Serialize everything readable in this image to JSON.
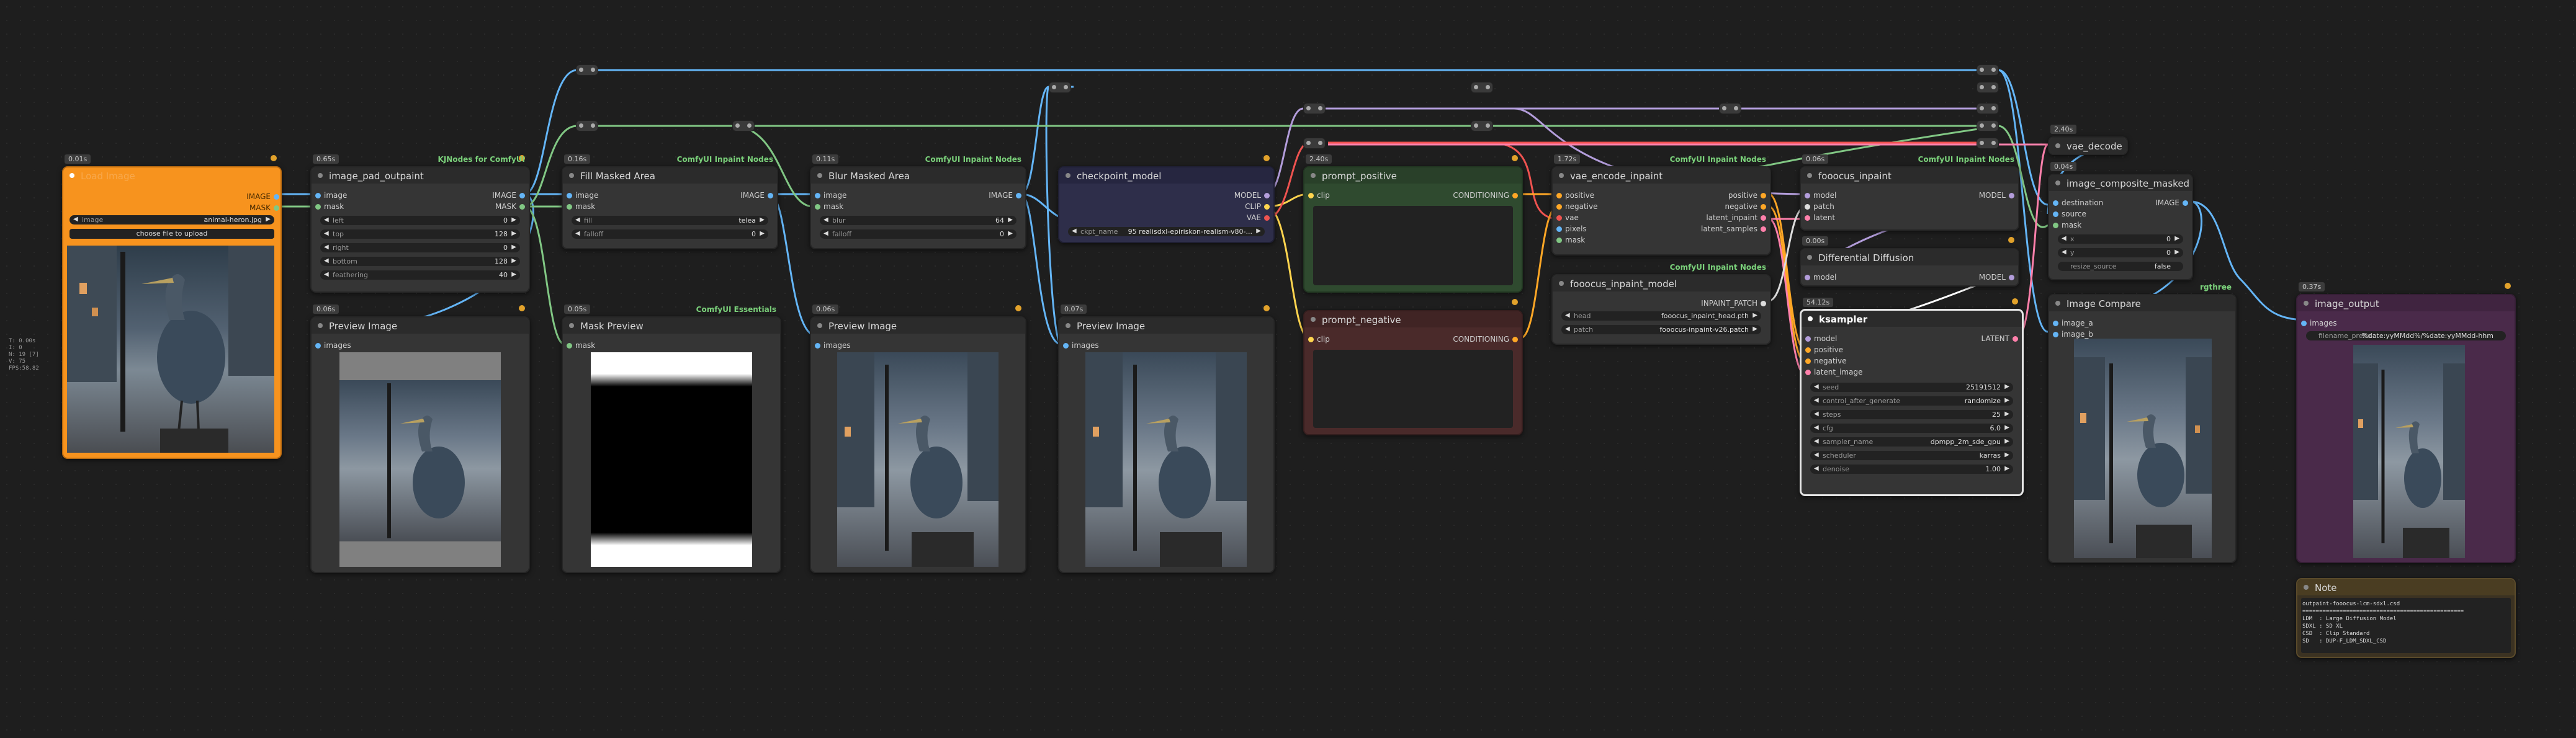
{
  "stats": [
    "T: 0.00s",
    "I: 0",
    "N: 19 [7]",
    "V: 75",
    "FPS:58.82"
  ],
  "colors": {
    "background": "#1e1e1e",
    "node_body": "#353535",
    "load_image": "#f7931e",
    "checkpoint": "#2e2e4a",
    "positive": "#2f4a2f",
    "negative": "#4a2a2a",
    "image_output": "#4a2a4a",
    "note": "#3b3222"
  },
  "nodes": {
    "load_image": {
      "title": "Load Image",
      "time": "0.01s",
      "image_label": "image",
      "image_value": "animal-heron.jpg",
      "upload_label": "choose file to upload",
      "outputs": [
        "IMAGE",
        "MASK"
      ]
    },
    "image_pad": {
      "title": "image_pad_outpaint",
      "time": "0.65s",
      "source": "KJNodes for ComfyUI",
      "inputs": [
        "image",
        "mask"
      ],
      "outputs": [
        "IMAGE",
        "MASK"
      ],
      "widgets": [
        {
          "label": "left",
          "value": "0"
        },
        {
          "label": "top",
          "value": "128"
        },
        {
          "label": "right",
          "value": "0"
        },
        {
          "label": "bottom",
          "value": "128"
        },
        {
          "label": "feathering",
          "value": "40"
        }
      ]
    },
    "fill_masked": {
      "title": "Fill Masked Area",
      "time": "0.16s",
      "source": "ComfyUI Inpaint Nodes",
      "inputs": [
        "image",
        "mask"
      ],
      "outputs": [
        "IMAGE"
      ],
      "widgets": [
        {
          "label": "fill",
          "value": "telea"
        },
        {
          "label": "falloff",
          "value": "0"
        }
      ]
    },
    "blur_masked": {
      "title": "Blur Masked Area",
      "time": "0.11s",
      "source": "ComfyUI Inpaint Nodes",
      "inputs": [
        "image",
        "mask"
      ],
      "outputs": [
        "IMAGE"
      ],
      "widgets": [
        {
          "label": "blur",
          "value": "64"
        },
        {
          "label": "falloff",
          "value": "0"
        }
      ]
    },
    "checkpoint": {
      "title": "checkpoint_model",
      "outputs": [
        "MODEL",
        "CLIP",
        "VAE"
      ],
      "ckpt_label": "ckpt_name",
      "ckpt_value": "95 realisdxl-epiriskon-realism-v80-..."
    },
    "prompt_positive": {
      "title": "prompt_positive",
      "time": "2.40s",
      "inputs": [
        "clip"
      ],
      "outputs": [
        "CONDITIONING"
      ]
    },
    "prompt_negative": {
      "title": "prompt_negative",
      "inputs": [
        "clip"
      ],
      "outputs": [
        "CONDITIONING"
      ]
    },
    "vae_encode": {
      "title": "vae_encode_inpaint",
      "time": "1.72s",
      "source": "ComfyUI Inpaint Nodes",
      "inputs": [
        "positive",
        "negative",
        "vae",
        "pixels",
        "mask"
      ],
      "outputs": [
        "positive",
        "negative",
        "latent_inpaint",
        "latent_samples"
      ]
    },
    "fooocus_model": {
      "title": "fooocus_inpaint_model",
      "source": "ComfyUI Inpaint Nodes",
      "outputs": [
        "INPAINT_PATCH"
      ],
      "widgets": [
        {
          "label": "head",
          "value": "fooocus_inpaint_head.pth"
        },
        {
          "label": "patch",
          "value": "fooocus-inpaint-v26.patch"
        }
      ]
    },
    "fooocus_inpaint": {
      "title": "fooocus_inpaint",
      "time": "0.06s",
      "source": "ComfyUI Inpaint Nodes",
      "inputs": [
        "model",
        "patch",
        "latent"
      ],
      "outputs": [
        "MODEL"
      ]
    },
    "diff_diffusion": {
      "title": "Differential Diffusion",
      "time": "0.00s",
      "inputs": [
        "model"
      ],
      "outputs": [
        "MODEL"
      ]
    },
    "ksampler": {
      "title": "ksampler",
      "time": "54.12s",
      "inputs": [
        "model",
        "positive",
        "negative",
        "latent_image"
      ],
      "outputs": [
        "LATENT"
      ],
      "widgets": [
        {
          "label": "seed",
          "value": "25191512"
        },
        {
          "label": "control_after_generate",
          "value": "randomize"
        },
        {
          "label": "steps",
          "value": "25"
        },
        {
          "label": "cfg",
          "value": "6.0"
        },
        {
          "label": "sampler_name",
          "value": "dpmpp_2m_sde_gpu"
        },
        {
          "label": "scheduler",
          "value": "karras"
        },
        {
          "label": "denoise",
          "value": "1.00"
        }
      ]
    },
    "vae_decode": {
      "title": "vae_decode",
      "time": "2.40s"
    },
    "image_composite": {
      "title": "image_composite_masked",
      "time": "0.04s",
      "inputs": [
        "destination",
        "source",
        "mask"
      ],
      "outputs": [
        "IMAGE"
      ],
      "widgets": [
        {
          "label": "x",
          "value": "0"
        },
        {
          "label": "y",
          "value": "0"
        }
      ],
      "resize_label": "resize_source",
      "resize_value": "false"
    },
    "image_compare": {
      "title": "Image Compare",
      "source": "rgthree",
      "inputs": [
        "image_a",
        "image_b"
      ]
    },
    "image_output": {
      "title": "image_output",
      "time": "0.37s",
      "inputs": [
        "images"
      ],
      "filename_label": "filename_prefix",
      "filename_value": "%date:yyMMdd%/%date:yyMMdd-hhm"
    },
    "preview1": {
      "title": "Preview Image",
      "time": "0.06s",
      "inputs": [
        "images"
      ]
    },
    "mask_preview": {
      "title": "Mask Preview",
      "time": "0.05s",
      "source": "ComfyUI Essentials",
      "inputs": [
        "mask"
      ]
    },
    "preview2": {
      "title": "Preview Image",
      "time": "0.06s",
      "inputs": [
        "images"
      ]
    },
    "preview3": {
      "title": "Preview Image",
      "time": "0.07s",
      "inputs": [
        "images"
      ]
    },
    "note": {
      "title": "Note",
      "text": "outpaint-fooocus-lcm-sdxl.csd\n================================================\nLDM  : Large Diffusion Model\nSDXL : SD XL\nCSD  : Clip Standard\nSD   : DUP-F_LDM_SDXL_CSD"
    }
  }
}
